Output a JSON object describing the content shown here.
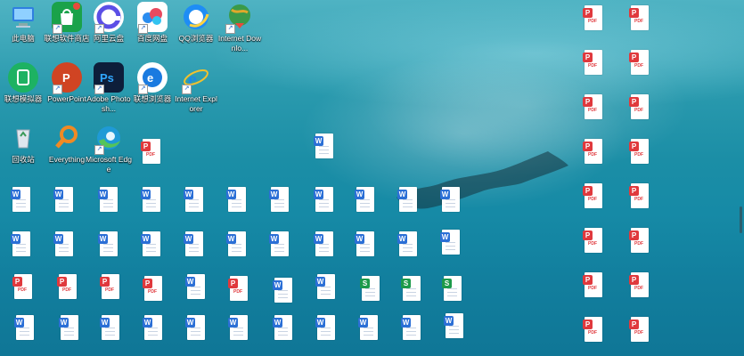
{
  "desktop": {
    "icons": [
      {
        "label": "此电脑",
        "icon": "computer-icon",
        "color": "#2f7fe0"
      },
      {
        "label": "联想软件商店",
        "icon": "store-bag-icon",
        "color": "#1aa24a"
      },
      {
        "label": "阿里云盘",
        "icon": "aliyun-drive-icon",
        "color": "#5b4fe6"
      },
      {
        "label": "百度网盘",
        "icon": "baidu-netdisk-icon",
        "color": "#2a8df0"
      },
      {
        "label": "QQ浏览器",
        "icon": "qq-browser-icon",
        "color": "#1e8df5"
      },
      {
        "label": "Internet Downlo...",
        "icon": "idm-globe-icon",
        "color": "#e0a82b"
      },
      {
        "label": "联想模拟器",
        "icon": "emulator-icon",
        "color": "#1db262"
      },
      {
        "label": "PowerPoint",
        "icon": "powerpoint-icon",
        "color": "#d04423"
      },
      {
        "label": "Adobe Photosh...",
        "icon": "photoshop-icon",
        "color": "#0d1e3a"
      },
      {
        "label": "联想浏览器",
        "icon": "lenovo-browser-icon",
        "color": "#1a7ae0"
      },
      {
        "label": "Internet Explorer",
        "icon": "internet-explorer-icon",
        "color": "#1e88e5"
      },
      {
        "label": "回收站",
        "icon": "recycle-bin-icon",
        "color": "#c8d0d8"
      },
      {
        "label": "Everything",
        "icon": "everything-search-icon",
        "color": "#f08a24"
      },
      {
        "label": "Microsoft Edge",
        "icon": "edge-icon",
        "color": "#1f9ad6"
      }
    ],
    "file_badges": {
      "word": "W",
      "pdf": "P",
      "sheet": "S",
      "pdf_text": "PDF",
      "shortcut": "↗"
    }
  },
  "colors": {
    "word": "#2b6fd6",
    "pdf": "#e0393d",
    "sheet": "#1d9a4a"
  }
}
